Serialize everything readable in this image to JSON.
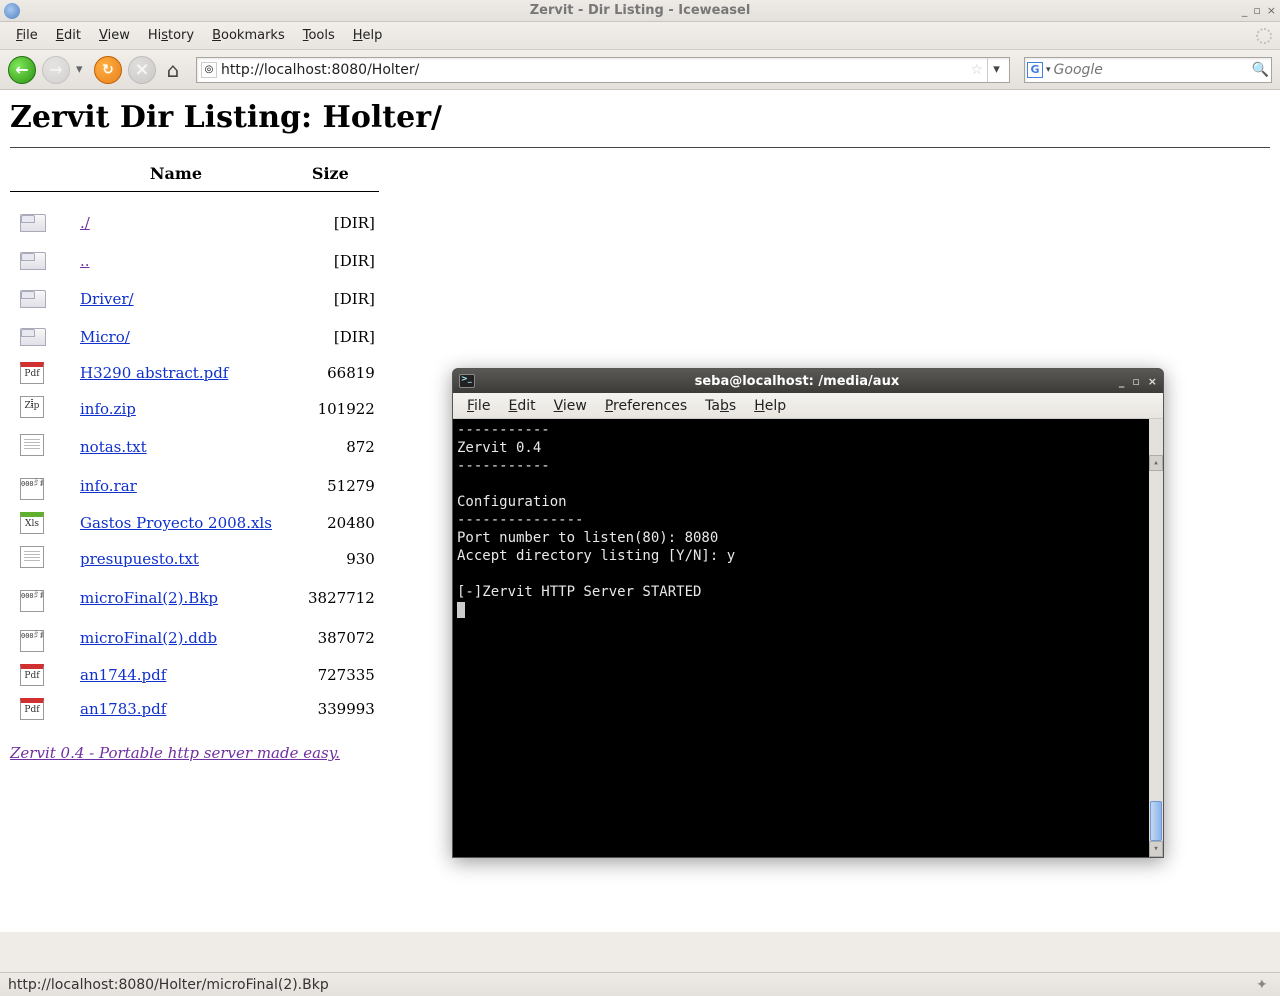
{
  "window": {
    "title": "Zervit - Dir Listing - Iceweasel"
  },
  "menubar": {
    "items": [
      "File",
      "Edit",
      "View",
      "History",
      "Bookmarks",
      "Tools",
      "Help"
    ]
  },
  "urlbar": {
    "value": "http://localhost:8080/Holter/"
  },
  "searchbar": {
    "engine_letter": "G",
    "placeholder": "Google"
  },
  "page": {
    "heading": "Zervit Dir Listing: Holter/",
    "columns": {
      "name": "Name",
      "size": "Size"
    },
    "entries": [
      {
        "icon": "folder",
        "name": "./",
        "size": "[DIR]"
      },
      {
        "icon": "folder",
        "name": "..",
        "size": "[DIR]"
      },
      {
        "icon": "folder",
        "name": "Driver/",
        "size": "[DIR]"
      },
      {
        "icon": "folder",
        "name": "Micro/",
        "size": "[DIR]"
      },
      {
        "icon": "pdf",
        "name": "H3290 abstract.pdf",
        "size": "66819"
      },
      {
        "icon": "zip",
        "name": "info.zip",
        "size": "101922"
      },
      {
        "icon": "txt",
        "name": "notas.txt",
        "size": "872"
      },
      {
        "icon": "bin",
        "name": "info.rar",
        "size": "51279"
      },
      {
        "icon": "xls",
        "name": "Gastos Proyecto 2008.xls",
        "size": "20480"
      },
      {
        "icon": "txt",
        "name": "presupuesto.txt",
        "size": "930"
      },
      {
        "icon": "bin",
        "name": "microFinal(2).Bkp",
        "size": "3827712"
      },
      {
        "icon": "bin",
        "name": "microFinal(2).ddb",
        "size": "387072"
      },
      {
        "icon": "pdf",
        "name": "an1744.pdf",
        "size": "727335"
      },
      {
        "icon": "pdf",
        "name": "an1783.pdf",
        "size": "339993"
      }
    ],
    "footer_link": "Zervit 0.4 - Portable http server made easy."
  },
  "statusbar": {
    "text": "http://localhost:8080/Holter/microFinal(2).Bkp"
  },
  "terminal": {
    "title": "seba@localhost: /media/aux",
    "menubar": [
      "File",
      "Edit",
      "View",
      "Preferences",
      "Tabs",
      "Help"
    ],
    "output": "-----------\nZervit 0.4\n-----------\n\nConfiguration\n---------------\nPort number to listen(80): 8080\nAccept directory listing [Y/N]: y\n\n[-]Zervit HTTP Server STARTED\n"
  }
}
